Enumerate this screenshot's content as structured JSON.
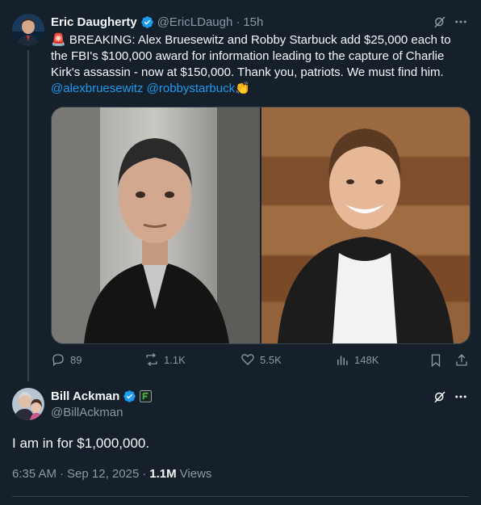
{
  "parent_tweet": {
    "author_name": "Eric Daugherty",
    "handle": "@EricLDaugh",
    "separator": "·",
    "time_ago": "15h",
    "siren_emoji": "🚨",
    "text_main": " BREAKING: Alex Bruesewitz and Robby Starbuck add $25,000 each to the FBI's $100,000 award for information leading to the capture of Charlie Kirk's assassin - now at $150,000. Thank you, patriots. We must find him.",
    "mention_1": "@alexbruesewitz",
    "mention_2": "@robbystarbuck",
    "clap_emoji": "👏",
    "actions": {
      "replies": "89",
      "reposts": "1.1K",
      "likes": "5.5K",
      "views": "148K"
    }
  },
  "main_tweet": {
    "author_name": "Bill Ackman",
    "handle": "@BillAckman",
    "text": "I am in for $1,000,000.",
    "time": "6:35 AM",
    "separator": "·",
    "date": "Sep 12, 2025",
    "views_count": "1.1M",
    "views_label": "Views"
  },
  "icons": {
    "verified": "verified-badge-icon",
    "grok": "grok-icon",
    "more": "more-icon",
    "reply": "reply-icon",
    "repost": "repost-icon",
    "like": "like-icon",
    "views": "views-icon",
    "bookmark": "bookmark-icon",
    "share": "share-icon",
    "affiliate": "affiliate-badge-icon"
  },
  "colors": {
    "background": "#15202b",
    "accent": "#1d9bf0",
    "muted_text": "#8b98a5",
    "divider": "#38444d"
  }
}
